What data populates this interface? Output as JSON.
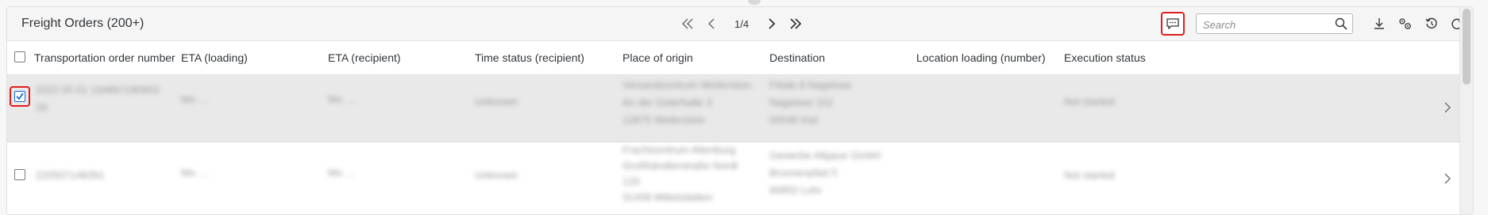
{
  "toolbar": {
    "title": "Freight Orders (200+)",
    "page_info": "1/4",
    "search_placeholder": "Search",
    "search_value": ""
  },
  "columns": [
    "Transportation order number",
    "ETA (loading)",
    "ETA (recipient)",
    "Time status (recipient)",
    "Place of origin",
    "Destination",
    "Location loading (number)",
    "Execution status"
  ],
  "rows": [
    {
      "selected": true,
      "order_number": [
        "2022 05 01 134867190903",
        "16"
      ],
      "eta_loading": "Mo …",
      "eta_recipient": "Mo …",
      "time_status": "Unknown",
      "origin": [
        "Versandzentrum Weilerstein",
        "An der Güterhalle 3",
        "12875 Weilerstein"
      ],
      "destination": [
        "Filiale 8 Nagelsee",
        "Nagelsee 152",
        "00546 Kiel"
      ],
      "location_loading": "",
      "execution_status": "Not started"
    },
    {
      "selected": false,
      "order_number": [
        "220507148391"
      ],
      "eta_loading": "Mo …",
      "eta_recipient": "Mo …",
      "time_status": "Unknown",
      "origin": [
        "Frachtzentrum Altenburg",
        "Großhändlerstraße Nordt",
        "120",
        "31458 Mittelstädten"
      ],
      "destination": [
        "Gewerbe Allgaue GmbH",
        "Brunnenpfad 5",
        "90852 Lohr"
      ],
      "location_loading": "",
      "execution_status": "Not started"
    }
  ],
  "colors": {
    "highlight": "#e01d1d",
    "checkbox_checked": "#0a6ed1",
    "selected_row": "#e9e9e9"
  },
  "icons": {
    "first": "double-chevron-left-icon",
    "prev": "chevron-left-icon",
    "next": "chevron-right-icon",
    "last": "double-chevron-right-icon",
    "comment": "comment-icon",
    "search": "search-icon",
    "download": "download-icon",
    "settings": "settings-icon",
    "history": "history-icon",
    "refresh": "refresh-icon"
  }
}
